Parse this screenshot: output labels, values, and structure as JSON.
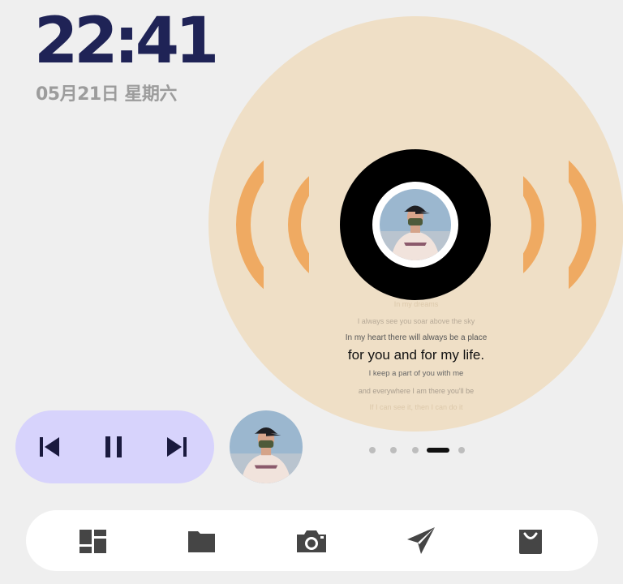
{
  "status": {
    "time": "22:41",
    "date": "05月21日 星期六"
  },
  "now_playing": {
    "lyrics": [
      "In my dreams",
      "I always see you soar above the sky",
      "In my heart there will always be a place",
      "for you and for my life.",
      "I keep a part of you with me",
      "and everywhere I am there you'll be",
      "If I can see it, then I can do it"
    ]
  },
  "player": {
    "controls": [
      "skip-previous-icon",
      "pause-icon",
      "skip-next-icon"
    ]
  },
  "pager": {
    "count": 5,
    "active_index": 3
  },
  "dock": {
    "items": [
      "dashboard-icon",
      "folder-icon",
      "camera-icon",
      "send-icon",
      "shopping-bag-icon"
    ]
  },
  "colors": {
    "clock": "#1f2356",
    "disc": "#efdfc6",
    "wave": "#efaa62",
    "player_bg": "#d7d3fc",
    "background": "#efefef"
  }
}
